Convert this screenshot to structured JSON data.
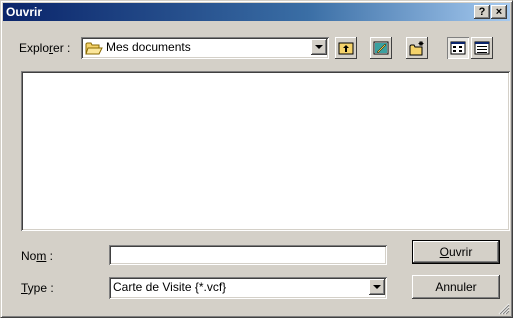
{
  "window": {
    "title": "Ouvrir",
    "help_button": "?",
    "close_button": "×"
  },
  "lookin": {
    "label_pre": "Explo",
    "label_accel": "r",
    "label_post": "er :",
    "value": "Mes documents",
    "icon": "folder-open-icon"
  },
  "toolbar": {
    "buttons": [
      {
        "name": "up-one-level",
        "icon": "folder-up-icon"
      },
      {
        "name": "desktop",
        "icon": "desktop-icon"
      },
      {
        "name": "new-folder",
        "icon": "new-folder-icon"
      },
      {
        "name": "list-view",
        "icon": "list-view-icon",
        "pressed": true
      },
      {
        "name": "details-view",
        "icon": "details-view-icon"
      }
    ]
  },
  "file_list": {
    "items": []
  },
  "filename": {
    "label_pre": "No",
    "label_accel": "m",
    "label_post": " :",
    "value": ""
  },
  "filetype": {
    "label_accel": "T",
    "label_post": "ype :",
    "value": "Carte de Visite {*.vcf}"
  },
  "buttons": {
    "open_accel": "O",
    "open_rest": "uvrir",
    "cancel": "Annuler"
  }
}
